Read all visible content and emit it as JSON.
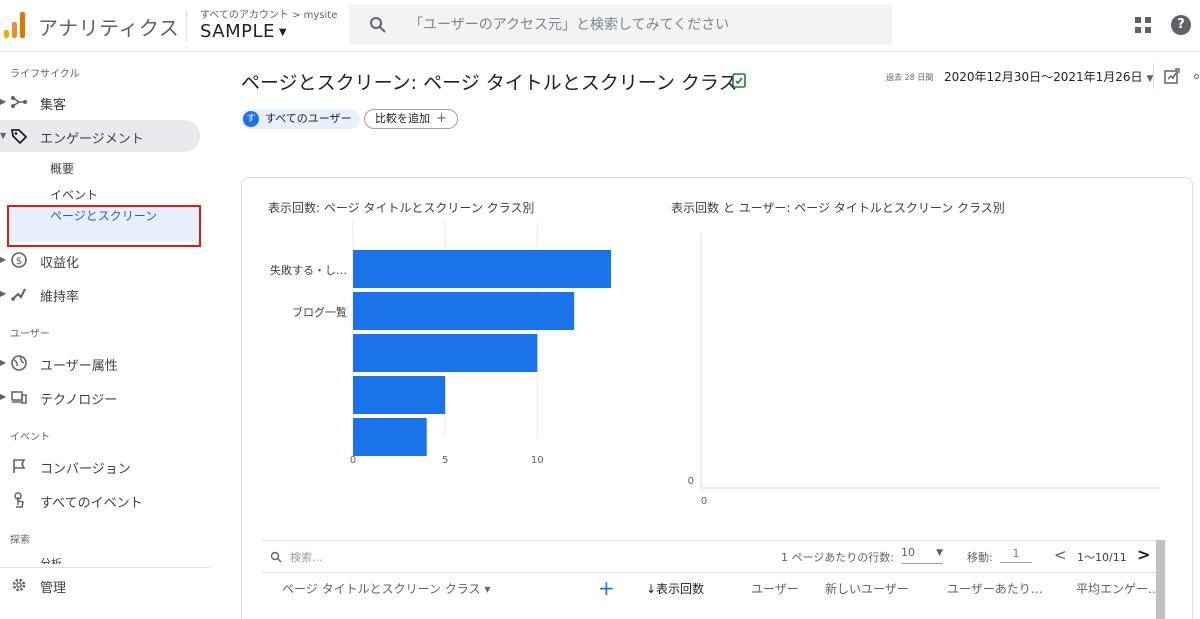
{
  "header": {
    "app_title": "アナリティクス",
    "breadcrumb": "すべてのアカウント > mysite",
    "account": "SAMPLE",
    "search_placeholder": "「ユーザーのアクセス元」と検索してみてください"
  },
  "sidebar": {
    "sections": {
      "lifecycle": "ライフサイクル",
      "user": "ユーザー",
      "event": "イベント",
      "explore": "探索"
    },
    "items": {
      "acquisition": "集客",
      "engagement": "エンゲージメント",
      "overview": "概要",
      "events": "イベント",
      "pages_screens": "ページとスクリーン",
      "monetization": "収益化",
      "retention": "維持率",
      "user_attributes": "ユーザー属性",
      "technology": "テクノロジー",
      "conversions": "コンバージョン",
      "all_events": "すべてのイベント",
      "analysis": "分析",
      "admin": "管理"
    }
  },
  "main": {
    "title": "ページとスクリーン: ページ タイトルとスクリーン クラス",
    "date_label": "過去 28 日間",
    "date_range": "2020年12月30日～2021年1月26日",
    "segment_chip": "すべてのユーザー",
    "segment_initial": "す",
    "compare_chip": "比較を追加",
    "chart1_title": "表示回数: ページ タイトルとスクリーン クラス別",
    "chart2_title": "表示回数 と ユーザー: ページ タイトルとスクリーン クラス別"
  },
  "chart_data": [
    {
      "type": "bar",
      "orientation": "horizontal",
      "title": "表示回数: ページ タイトルとスクリーン クラス別",
      "categories": [
        "失敗する・し…",
        "ブログ一覧",
        "",
        "",
        ""
      ],
      "values": [
        14,
        12,
        10,
        5,
        4
      ],
      "xlim": [
        0,
        14
      ],
      "xticks": [
        0,
        5,
        10
      ],
      "color": "#1a73e8",
      "grid": true
    },
    {
      "type": "scatter",
      "title": "表示回数 と ユーザー: ページ タイトルとスクリーン クラス別",
      "xticks": [
        0
      ],
      "yticks": [
        0
      ],
      "points": []
    }
  ],
  "table": {
    "search_placeholder": "検索...",
    "rows_label": "1 ページあたりの行数:",
    "rows_value": "10",
    "goto_label": "移動:",
    "goto_value": "1",
    "range": "1～10/11",
    "columns": [
      "ページ タイトルとスクリーン クラス",
      "↓表示回数",
      "ユーザー",
      "新しいユーザー",
      "ユーザーあたり…",
      "平均エンゲー…"
    ]
  }
}
